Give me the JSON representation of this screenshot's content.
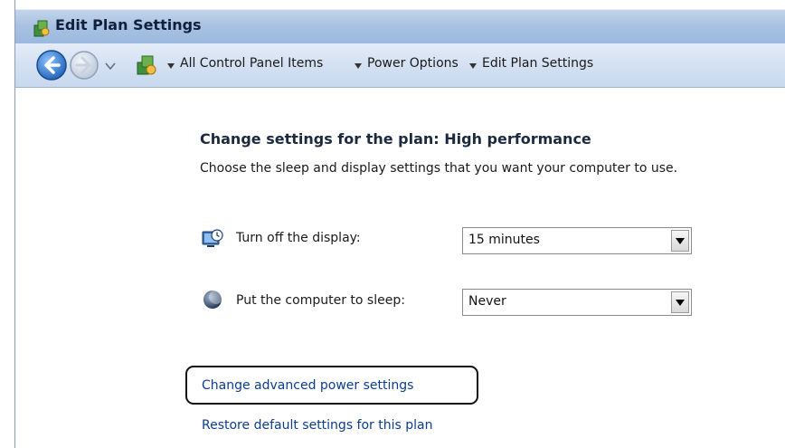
{
  "window": {
    "title": "Edit Plan Settings"
  },
  "breadcrumb": {
    "items": [
      "All Control Panel Items",
      "Power Options",
      "Edit Plan Settings"
    ]
  },
  "main": {
    "heading": "Change settings for the plan: High performance",
    "description": "Choose the sleep and display settings that you want your computer to use.",
    "settings": [
      {
        "label": "Turn off the display:",
        "value": "15 minutes",
        "icon": "display-icon"
      },
      {
        "label": "Put the computer to sleep:",
        "value": "Never",
        "icon": "sleep-icon"
      }
    ],
    "links": {
      "advanced": "Change advanced power settings",
      "restore": "Restore default settings for this plan"
    }
  },
  "colors": {
    "title_bar": "#a9c2e2",
    "nav_bar": "#d3e0f2",
    "link": "#0b3d8c",
    "back_button": "#2f7fd6"
  }
}
